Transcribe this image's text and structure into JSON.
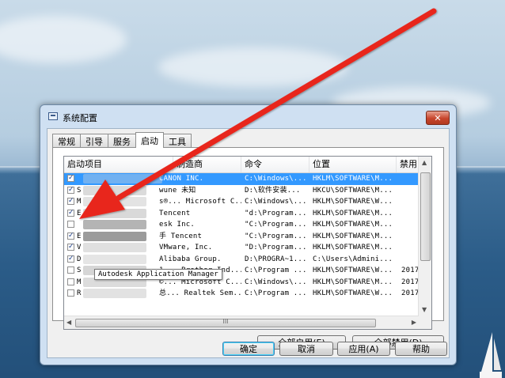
{
  "window": {
    "title": "系统配置",
    "close_label": "✕"
  },
  "tabs": [
    {
      "label": "常规",
      "active": false
    },
    {
      "label": "引导",
      "active": false
    },
    {
      "label": "服务",
      "active": false
    },
    {
      "label": "启动",
      "active": true
    },
    {
      "label": "工具",
      "active": false
    }
  ],
  "table": {
    "columns": [
      "启动项目",
      "制造商",
      "命令",
      "位置",
      "禁用日期"
    ],
    "rows": [
      {
        "checked": true,
        "name": "",
        "maker": "CANON INC.",
        "command": "C:\\Windows\\...",
        "location": "HKLM\\SOFTWARE\\M...",
        "date": "",
        "selected": true
      },
      {
        "checked": true,
        "name": "S",
        "maker": "wune  未知",
        "command": "D:\\软件安装...",
        "location": "HKCU\\SOFTWARE\\M...",
        "date": ""
      },
      {
        "checked": true,
        "name": "M",
        "maker": "s®...  Microsoft C...",
        "command": "C:\\Windows\\...",
        "location": "HKLM\\SOFTWARE\\W...",
        "date": ""
      },
      {
        "checked": true,
        "name": "E",
        "maker": "Tencent",
        "command": "\"d:\\Program...",
        "location": "HKLM\\SOFTWARE\\M...",
        "date": ""
      },
      {
        "checked": false,
        "name": "",
        "maker": "esk Inc.",
        "command": "\"C:\\Program...",
        "location": "HKLM\\SOFTWARE\\M...",
        "date": ""
      },
      {
        "checked": true,
        "name": "E",
        "maker": "手  Tencent",
        "command": "\"C:\\Program...",
        "location": "HKLM\\SOFTWARE\\M...",
        "date": ""
      },
      {
        "checked": true,
        "name": "V",
        "maker": "VMware, Inc.",
        "command": "\"D:\\Program...",
        "location": "HKLM\\SOFTWARE\\M...",
        "date": ""
      },
      {
        "checked": true,
        "name": "D",
        "maker": "Alibaba Group.",
        "command": "D:\\PROGRA~1...",
        "location": "C:\\Users\\Admini...",
        "date": ""
      },
      {
        "checked": false,
        "name": "S",
        "maker": "1...  Brother Ind...",
        "command": "C:\\Program ...",
        "location": "HKLM\\SOFTWARE\\W...",
        "date": "2017/"
      },
      {
        "checked": false,
        "name": "M",
        "maker": "©...  Microsoft C...",
        "command": "C:\\Windows\\...",
        "location": "HKLM\\SOFTWARE\\M...",
        "date": "2017/"
      },
      {
        "checked": false,
        "name": "R",
        "maker": "总...  Realtek Sem...",
        "command": "C:\\Program ...",
        "location": "HKLM\\SOFTWARE\\W...",
        "date": "2017/"
      }
    ]
  },
  "tooltip": "Autodesk Application Manager",
  "scrollbar": {
    "h_thumb_label": "III"
  },
  "buttons": {
    "enable_all": "全部启用(E)",
    "disable_all": "全部禁用(D)",
    "ok": "确定",
    "cancel": "取消",
    "apply": "应用(A)",
    "help": "帮助"
  },
  "colors": {
    "selection": "#3399ff",
    "annotation_arrow": "#e8261d",
    "close_button": "#c7452c"
  }
}
